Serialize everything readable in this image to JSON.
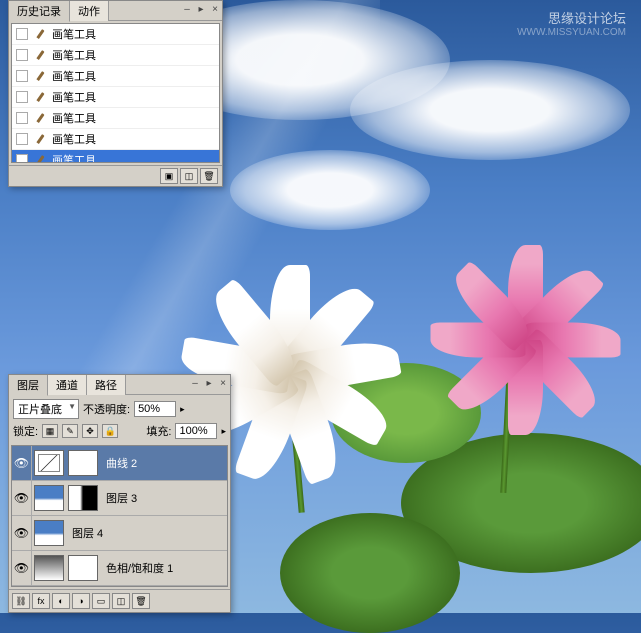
{
  "watermark": {
    "main": "思缘设计论坛",
    "sub": "WWW.MISSYUAN.COM"
  },
  "history": {
    "tabs": {
      "history": "历史记录",
      "actions": "动作"
    },
    "items": [
      {
        "label": "画笔工具",
        "selected": false
      },
      {
        "label": "画笔工具",
        "selected": false
      },
      {
        "label": "画笔工具",
        "selected": false
      },
      {
        "label": "画笔工具",
        "selected": false
      },
      {
        "label": "画笔工具",
        "selected": false
      },
      {
        "label": "画笔工具",
        "selected": false
      },
      {
        "label": "画笔工具",
        "selected": true
      }
    ]
  },
  "layers": {
    "tabs": {
      "layers": "图层",
      "channels": "通道",
      "paths": "路径"
    },
    "blend_label": "正片叠底",
    "opacity_label": "不透明度:",
    "opacity_value": "50%",
    "lock_label": "锁定:",
    "fill_label": "填充:",
    "fill_value": "100%",
    "items": [
      {
        "name": "曲线 2",
        "selected": true,
        "thumb": "curves",
        "mask": "white"
      },
      {
        "name": "图层 3",
        "selected": false,
        "thumb": "sky",
        "mask": "partial"
      },
      {
        "name": "图层 4",
        "selected": false,
        "thumb": "sky",
        "mask": "none"
      },
      {
        "name": "色相/饱和度 1",
        "selected": false,
        "thumb": "gradient",
        "mask": "white"
      }
    ]
  }
}
